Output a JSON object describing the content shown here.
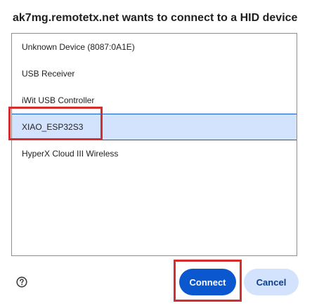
{
  "dialog": {
    "title": "ak7mg.remotetx.net wants to connect to a HID device"
  },
  "devices": [
    {
      "label": "Unknown Device (8087:0A1E)",
      "selected": false
    },
    {
      "label": "USB Receiver",
      "selected": false
    },
    {
      "label": "iWit USB Controller",
      "selected": false
    },
    {
      "label": "XIAO_ESP32S3",
      "selected": true
    },
    {
      "label": "HyperX Cloud III Wireless",
      "selected": false
    }
  ],
  "footer": {
    "help_icon": "help-circle-icon",
    "connect_label": "Connect",
    "cancel_label": "Cancel"
  },
  "colors": {
    "accent": "#0b57d0",
    "selected_bg": "#d3e3fd",
    "annotation": "#d32f2f"
  }
}
